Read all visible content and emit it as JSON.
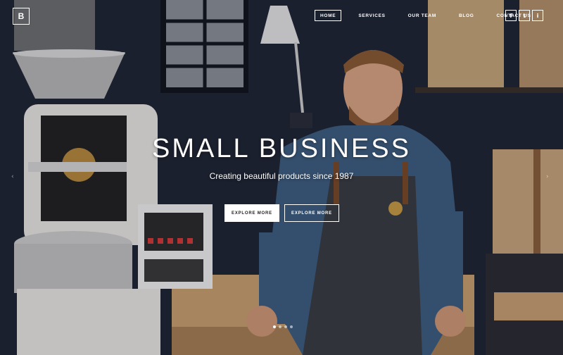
{
  "logo": {
    "letter": "B"
  },
  "nav": {
    "items": [
      {
        "label": "HOME",
        "active": true
      },
      {
        "label": "SERVICES",
        "active": false
      },
      {
        "label": "OUR TEAM",
        "active": false
      },
      {
        "label": "BLOG",
        "active": false
      },
      {
        "label": "CONTACT US",
        "active": false
      }
    ]
  },
  "social": {
    "facebook": "f",
    "twitter": "t",
    "instagram": "i"
  },
  "hero": {
    "title": "SMALL BUSINESS",
    "subtitle": "Creating beautiful products since 1987",
    "buttons": {
      "primary": "EXPLORE MORE",
      "secondary": "EXPLORE MORE"
    },
    "active_slide": 1,
    "slide_count": 4
  },
  "arrows": {
    "prev": "‹",
    "next": "›"
  },
  "colors": {
    "wall": "#1e2433",
    "wood": "#b08a5a",
    "machine": "#e9e7e2"
  }
}
